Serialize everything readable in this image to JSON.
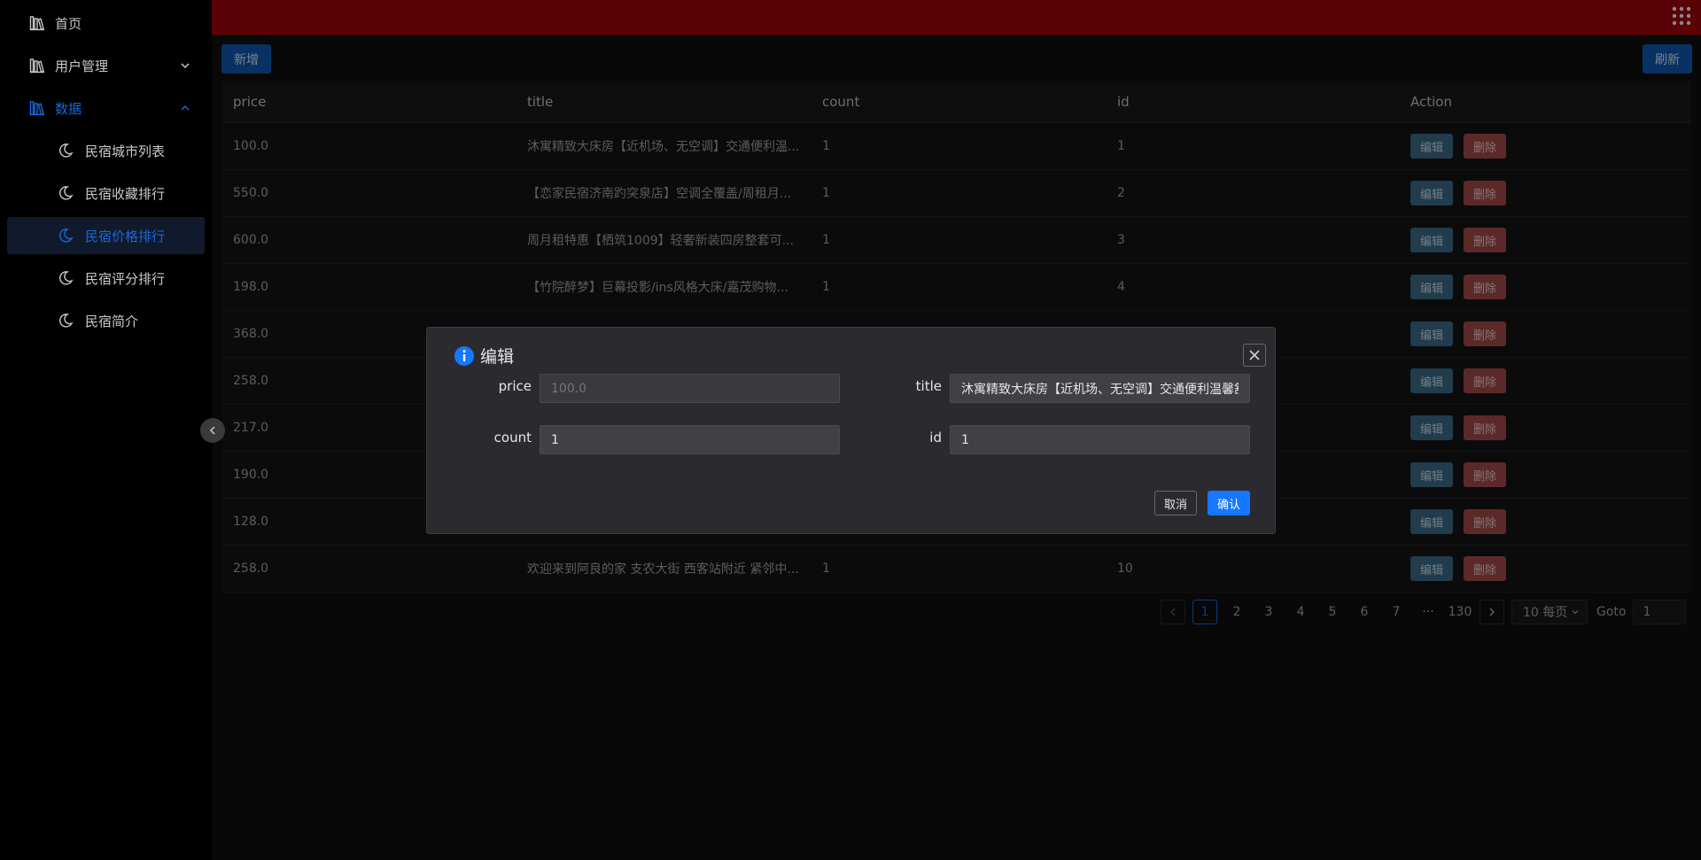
{
  "sidebar": {
    "items": [
      {
        "label": "首页"
      },
      {
        "label": "用户管理"
      },
      {
        "label": "数据"
      }
    ],
    "sub_items": [
      {
        "label": "民宿城市列表"
      },
      {
        "label": "民宿收藏排行"
      },
      {
        "label": "民宿价格排行"
      },
      {
        "label": "民宿评分排行"
      },
      {
        "label": "民宿简介"
      }
    ]
  },
  "toolbar": {
    "add_label": "新增",
    "refresh_label": "刷新"
  },
  "colors": {
    "header_bg": "#5a0206",
    "primary": "#1677ff",
    "edit_btn": "#3c6e8a",
    "delete_btn": "#a84b4b",
    "active_menu": "#1668dc"
  },
  "table": {
    "columns": [
      "price",
      "title",
      "count",
      "id",
      "Action"
    ],
    "action_labels": {
      "edit": "编辑",
      "delete": "删除"
    },
    "rows": [
      {
        "price": "100.0",
        "title": "沐寓精致大床房【近机场、无空调】交通便利温...",
        "count": "1",
        "id": "1"
      },
      {
        "price": "550.0",
        "title": "【恋家民宿济南趵突泉店】空调全覆盖/周租月...",
        "count": "1",
        "id": "2"
      },
      {
        "price": "600.0",
        "title": "周月租特惠【栖筑1009】轻奢新装四房整套可...",
        "count": "1",
        "id": "3"
      },
      {
        "price": "198.0",
        "title": "【竹院醉梦】巨幕投影/ins风格大床/嘉茂购物...",
        "count": "1",
        "id": "4"
      },
      {
        "price": "368.0",
        "title": "",
        "count": "",
        "id": ""
      },
      {
        "price": "258.0",
        "title": "",
        "count": "",
        "id": ""
      },
      {
        "price": "217.0",
        "title": "",
        "count": "",
        "id": ""
      },
      {
        "price": "190.0",
        "title": "",
        "count": "",
        "id": ""
      },
      {
        "price": "128.0",
        "title": "",
        "count": "",
        "id": ""
      },
      {
        "price": "258.0",
        "title": "欢迎来到阿良的家 支农大街 西客站附近 紧邻中...",
        "count": "1",
        "id": "10"
      }
    ]
  },
  "pagination": {
    "pages": [
      "1",
      "2",
      "3",
      "4",
      "5",
      "6",
      "7",
      "···",
      "130"
    ],
    "current": "1",
    "page_size": "10 每页",
    "goto_label": "Goto",
    "goto_value": "1"
  },
  "modal": {
    "title": "编辑",
    "fields": {
      "price_label": "price",
      "price_placeholder": "100.0",
      "title_label": "title",
      "title_value": "沐寓精致大床房【近机场、无空调】交通便利温馨舒适",
      "count_label": "count",
      "count_value": "1",
      "id_label": "id",
      "id_value": "1"
    },
    "cancel_label": "取消",
    "ok_label": "确认"
  }
}
